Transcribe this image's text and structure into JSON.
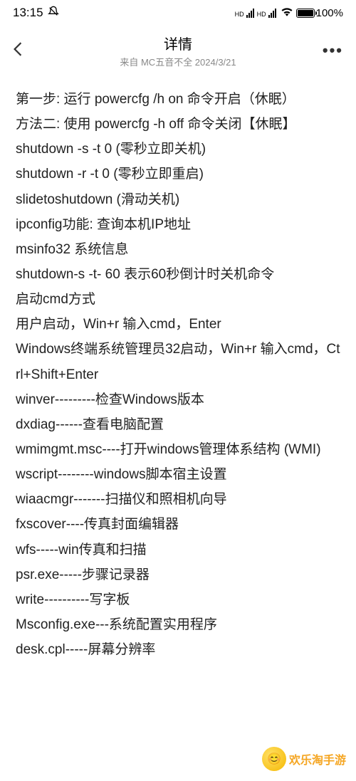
{
  "status": {
    "time": "13:15",
    "signal1": "HD",
    "signal2": "HD",
    "battery": "100%"
  },
  "header": {
    "title": "详情",
    "subtitle": "来自 MC五音不全 2024/3/21",
    "more": "•••"
  },
  "lines": [
    "第一步: 运行 powercfg /h on 命令开启（休眠）",
    "方法二: 使用 powercfg -h off 命令关闭【休眠】",
    "shutdown -s -t 0 (零秒立即关机)",
    "shutdown -r -t 0 (零秒立即重启)",
    "slidetoshutdown (滑动关机)",
    "ipconfig功能: 查询本机IP地址",
    "msinfo32 系统信息",
    "shutdown-s -t- 60 表示60秒倒计时关机命令",
    "启动cmd方式",
    "用户启动，Win+r 输入cmd，Enter",
    "Windows终端系统管理员32启动，Win+r 输入cmd，Ctrl+Shift+Enter",
    "winver---------检查Windows版本",
    "dxdiag------查看电脑配置",
    "wmimgmt.msc----打开windows管理体系结构 (WMI)",
    "wscript--------windows脚本宿主设置",
    "wiaacmgr-------扫描仪和照相机向导",
    "fxscover----传真封面编辑器",
    "wfs-----win传真和扫描",
    "psr.exe-----步骤记录器",
    "write----------写字板",
    "Msconfig.exe---系统配置实用程序",
    "desk.cpl-----屏幕分辨率"
  ],
  "watermark": {
    "text": "欢乐淘手游"
  }
}
